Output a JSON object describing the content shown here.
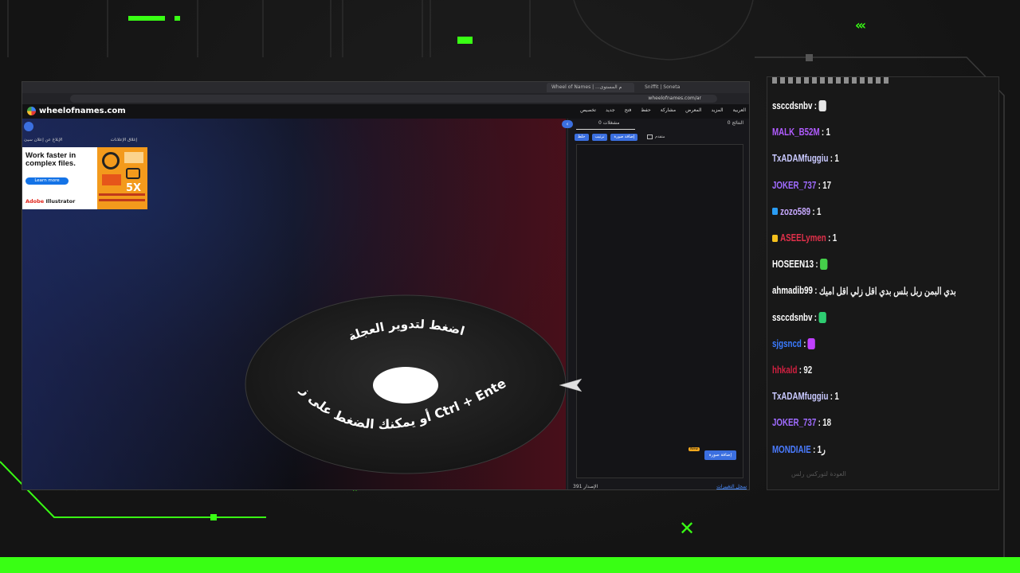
{
  "colors": {
    "accent": "#39ff14",
    "wheel_blue": "#3b6fe0"
  },
  "browser": {
    "tabs": [
      "Wheel of Names | ...م المستوى",
      "Sniffit | Soneta"
    ],
    "address": "wheelofnames.com/ar"
  },
  "site": {
    "logo": "wheelofnames.com",
    "menu": [
      "العربية",
      "المزيد",
      "المعرض",
      "مشاركة",
      "حفظ",
      "فتح",
      "جديد",
      "تخصيص"
    ],
    "links": [
      "إغلاق الإعلانات",
      "الإبلاغ عن إعلان سيئ"
    ]
  },
  "ad": {
    "headline": "Work faster in complex files.",
    "button": "Learn more",
    "brand_a": "Adobe",
    "brand_b": "Illustrator",
    "art_label": "5X"
  },
  "wheel": {
    "top_text": "اضغط لتدوير العجلة",
    "bottom_text": "أو يمكنك الضغط على زر Ctrl + Enter"
  },
  "panel": {
    "tabs": [
      "مشغلات",
      "النتائج"
    ],
    "tab_count_1": "0",
    "tab_count_2": "0",
    "buttons": [
      "ترتيب",
      "خلط",
      "إضافة صورة",
      "متقدم"
    ],
    "add_image": "إضافة صورة",
    "new_badge": "New",
    "version_label": "الإصدار",
    "version": "391",
    "changelog": "سجل التغييرات"
  },
  "chat": {
    "messages": [
      {
        "user": "ssccdsnbv",
        "text": "",
        "color": "#ffffff",
        "emote": "#e6e6e6"
      },
      {
        "user": "MALK_B52M",
        "text": "1",
        "color": "#b15cff",
        "emote": ""
      },
      {
        "user": "TxADAMfuggiu",
        "text": "1",
        "color": "#c9c9ff",
        "emote": ""
      },
      {
        "user": "JOKER_737",
        "text": "17",
        "color": "#9f6bff",
        "emote": ""
      },
      {
        "user": "zozo589",
        "text": "1",
        "color": "#c7a8ff",
        "badge": "#2a9df4"
      },
      {
        "user": "ASEELymen",
        "text": "1",
        "color": "#e0304a",
        "badge": "#f4c01d"
      },
      {
        "user": "HOSEEN13",
        "text": "",
        "color": "#ffffff",
        "emote": "#45d04a"
      },
      {
        "user": "ahmadib99",
        "text": "بدي البمن ربل بلس بدي اقل زلي اقل اميك",
        "color": "#ffffff",
        "emote": ""
      },
      {
        "user": "ssccdsnbv",
        "text": "",
        "color": "#ffffff",
        "emote": "#2ecc71"
      },
      {
        "user": "sjgsncd",
        "text": "",
        "color": "#3b7bff",
        "emote": "#c040ff"
      },
      {
        "user": "hhkald",
        "text": "92",
        "color": "#d02040",
        "emote": ""
      },
      {
        "user": "TxADAMfuggiu",
        "text": "1",
        "color": "#c9c9ff",
        "emote": ""
      },
      {
        "user": "JOKER_737",
        "text": "18",
        "color": "#9f6bff",
        "emote": ""
      },
      {
        "user": "MONDIAIE",
        "text": "1ر",
        "color": "#4a7bff",
        "emote": ""
      }
    ],
    "faded": "العودة لتوركس رلس"
  }
}
